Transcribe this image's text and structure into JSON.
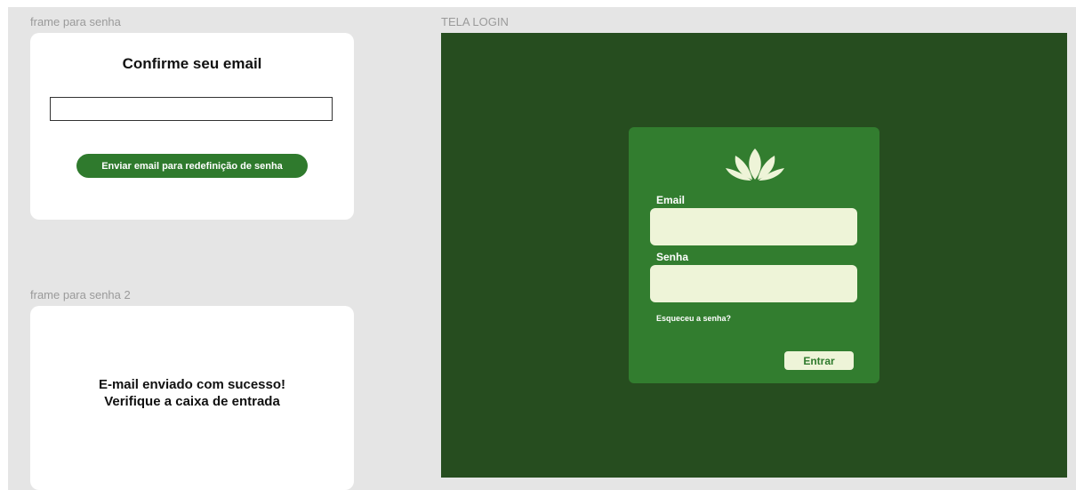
{
  "colors": {
    "canvas_background": "#e5e5e5",
    "card_background": "#ffffff",
    "primary_green": "#2f7a2d",
    "login_frame_background": "#264d1f",
    "login_card_background": "#327d2f",
    "input_background": "#eef4d8"
  },
  "frame_password": {
    "label": "frame para senha",
    "title": "Confirme seu email",
    "email_input_value": "",
    "button_label": "Enviar email para redefinição de senha"
  },
  "frame_password_2": {
    "label": "frame para senha 2",
    "message_line1": "E-mail enviado com sucesso!",
    "message_line2": "Verifique a caixa de entrada"
  },
  "login_screen": {
    "label": "TELA LOGIN",
    "logo_icon": "lotus-icon",
    "email_label": "Email",
    "email_value": "",
    "password_label": "Senha",
    "password_value": "",
    "forgot_password_link": "Esqueceu a senha?",
    "enter_button": "Entrar"
  }
}
